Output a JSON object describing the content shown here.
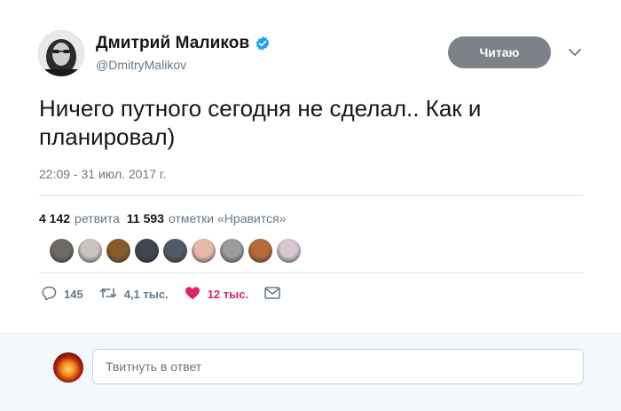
{
  "author": {
    "name": "Дмитрий Маликов",
    "handle": "@DmitryMalikov",
    "verified_icon": "verified-badge-icon",
    "verified_color": "#1da1f2"
  },
  "follow_button": {
    "label": "Читаю",
    "color": "#7d8288"
  },
  "menu_icon": "chevron-down-icon",
  "tweet": {
    "text": "Ничего путного сегодня не сделал.. Как и\nпланировал)",
    "timestamp": "22:09 - 31 июл. 2017 г."
  },
  "stats": {
    "retweets_count": "4 142",
    "retweets_label": "ретвита",
    "likes_count": "11 593",
    "likes_label": "отметки «Нравится»"
  },
  "likers": [
    {
      "color": "#6e6a66"
    },
    {
      "color": "#c9c4bd"
    },
    {
      "color": "#8a5a2b"
    },
    {
      "color": "#3d4550"
    },
    {
      "color": "#525a66"
    },
    {
      "color": "#e8b9a8"
    },
    {
      "color": "#9c9c9c"
    },
    {
      "color": "#b56a3c"
    },
    {
      "color": "#d8c6d0"
    }
  ],
  "actions": {
    "reply_count": "145",
    "retweet_count": "4,1 тыс.",
    "like_count": "12 тыс.",
    "like_color": "#e0245e"
  },
  "reply": {
    "placeholder": "Твитнуть в ответ"
  }
}
